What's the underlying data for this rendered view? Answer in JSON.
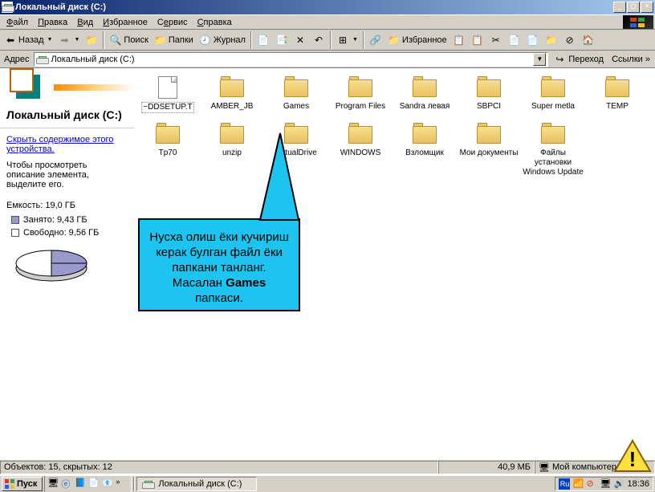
{
  "title": "Локальный диск (C:)",
  "menu": {
    "file": "Файл",
    "edit": "Правка",
    "view": "Вид",
    "fav": "Избранное",
    "tools": "Сервис",
    "help": "Справка"
  },
  "toolbar": {
    "back": "Назад",
    "search": "Поиск",
    "folders": "Папки",
    "journal": "Журнал",
    "fav": "Избранное"
  },
  "address": {
    "label": "Адрес",
    "value": "Локальный диск (C:)",
    "go": "Переход",
    "links": "Ссылки"
  },
  "sidebar": {
    "title": "Локальный диск (C:)",
    "link": "Скрыть содержимое этого устройства.",
    "hint": "Чтобы просмотреть описание элемента, выделите его.",
    "capacity": "Емкость: 19,0 ГБ",
    "used": "Занято: 9,43 ГБ",
    "free": "Свободно: 9,56 ГБ"
  },
  "folders_row1": [
    {
      "name": "~DDSETUP.T",
      "type": "file"
    },
    {
      "name": "AMBER_JB",
      "type": "folder"
    },
    {
      "name": "Games",
      "type": "folder"
    },
    {
      "name": "Program Files",
      "type": "folder"
    },
    {
      "name": "Sandra левая",
      "type": "folder"
    },
    {
      "name": "SBPCI",
      "type": "folder"
    },
    {
      "name": "Super metla",
      "type": "folder"
    },
    {
      "name": "TEMP",
      "type": "folder"
    }
  ],
  "folders_row2": [
    {
      "name": "Tp70",
      "type": "folder"
    },
    {
      "name": "unzip",
      "type": "folder"
    },
    {
      "name": "VirtualDrive",
      "type": "folder"
    },
    {
      "name": "WINDOWS",
      "type": "folder"
    },
    {
      "name": "Взломщик",
      "type": "folder"
    },
    {
      "name": "Мои документы",
      "type": "folder"
    },
    {
      "name": "Файлы установки Windows Update",
      "type": "folder"
    }
  ],
  "callout": {
    "line1": "Нусха олиш ёки кучириш керак булган файл ёки папкани танланг.",
    "line2a": "Масалан ",
    "line2b": "Games",
    "line2c": " папкаси."
  },
  "status": {
    "objects": "Объектов: 15, скрытых: 12",
    "size": "40,9 МБ",
    "loc": "Мой компьютер"
  },
  "taskbar": {
    "start": "Пуск",
    "task": "Локальный диск (C:)",
    "lang": "Ru",
    "time": "18:36"
  }
}
